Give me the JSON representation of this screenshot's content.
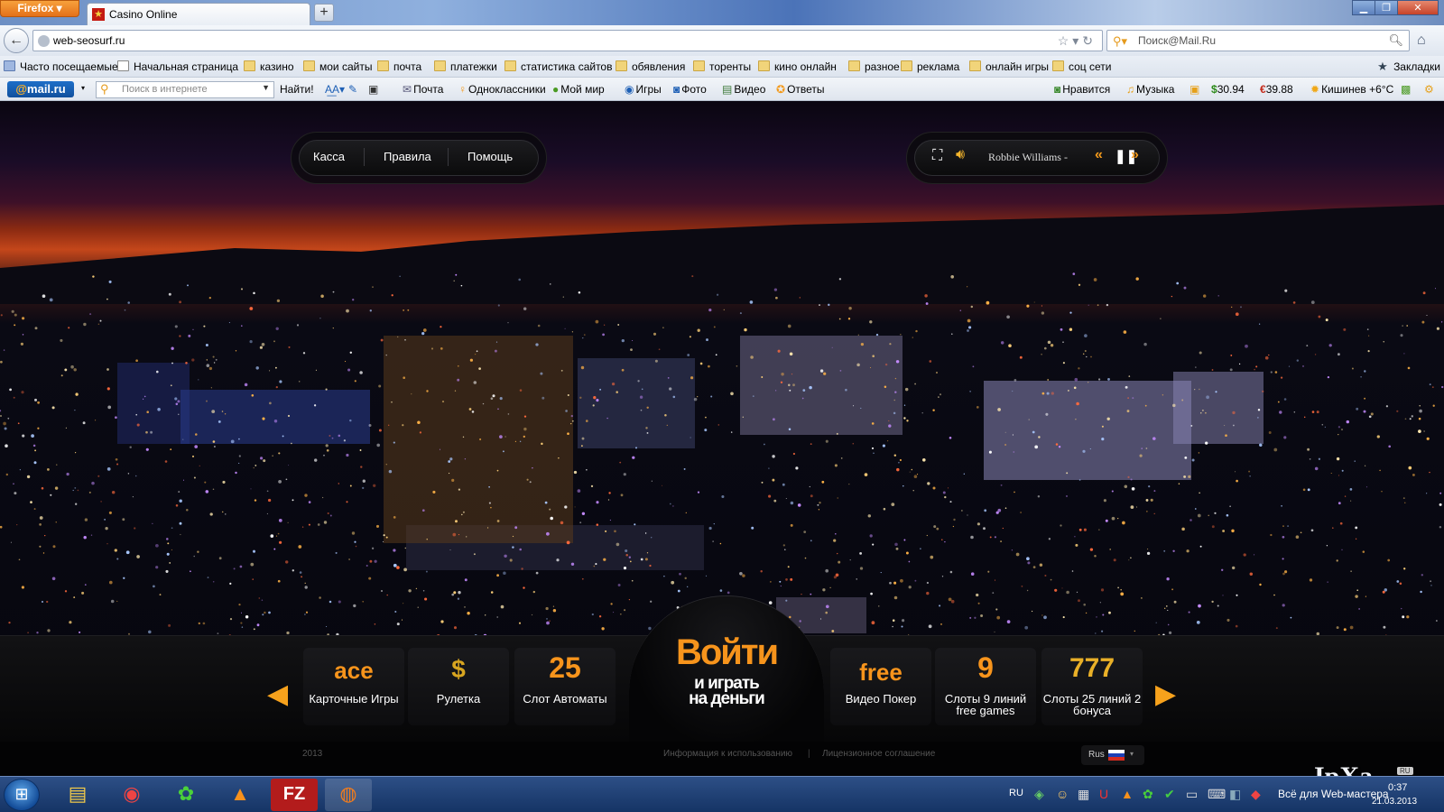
{
  "browser": {
    "app_button": "Firefox",
    "tab_title": "Casino Online",
    "new_tab": "+",
    "url": "web-seosurf.ru",
    "search_placeholder": "Поиск@Mail.Ru"
  },
  "bookmarks": [
    "Часто посещаемые",
    "Начальная страница",
    "казино",
    "мои сайты",
    "почта",
    "платежки",
    "статистика сайтов",
    "обявления",
    "торенты",
    "кино онлайн",
    "разное",
    "реклама",
    "онлайн игры",
    "соц сети"
  ],
  "bookmarks_end": "Закладки",
  "mailbar": {
    "logo_at": "@",
    "logo_text": "mail.ru",
    "search_placeholder": "Поиск в интернете",
    "find": "Найти!",
    "links": [
      "Почта",
      "Одноклассники",
      "Мой мир",
      "Игры",
      "Фото",
      "Видео",
      "Ответы"
    ],
    "like": "Нравится",
    "music": "Музыка",
    "usd": "30.94",
    "eur": "39.88",
    "weather": "Кишинев +6°C"
  },
  "site": {
    "menu": [
      "Касса",
      "Правила",
      "Помощь"
    ],
    "player_track": "Robbie Williams -",
    "login_big": "Войти",
    "login_small_1": "и играть",
    "login_small_2": "на деньги",
    "games": [
      {
        "icon": "ace",
        "label": "Карточные Игры"
      },
      {
        "icon": "$",
        "label": "Рулетка"
      },
      {
        "icon": "25",
        "label": "Слот Автоматы"
      },
      {
        "icon": "free",
        "label": "Видео Покер"
      },
      {
        "icon": "9",
        "label": "Слоты 9 линий free games"
      },
      {
        "icon": "777",
        "label": "Слоты 25 линий 2 бонуса"
      }
    ],
    "footer_year": "2013",
    "footer_info": "Информация к использованию",
    "footer_sep": "|",
    "footer_license": "Лицензионное соглашение",
    "lang": "Rus"
  },
  "watermark": {
    "logo": "IpXa",
    "badge": "RU",
    "slogan": "Всё для Web-мастера"
  },
  "taskbar": {
    "lang": "RU",
    "time": "0:37",
    "date": "21.03.2013"
  }
}
